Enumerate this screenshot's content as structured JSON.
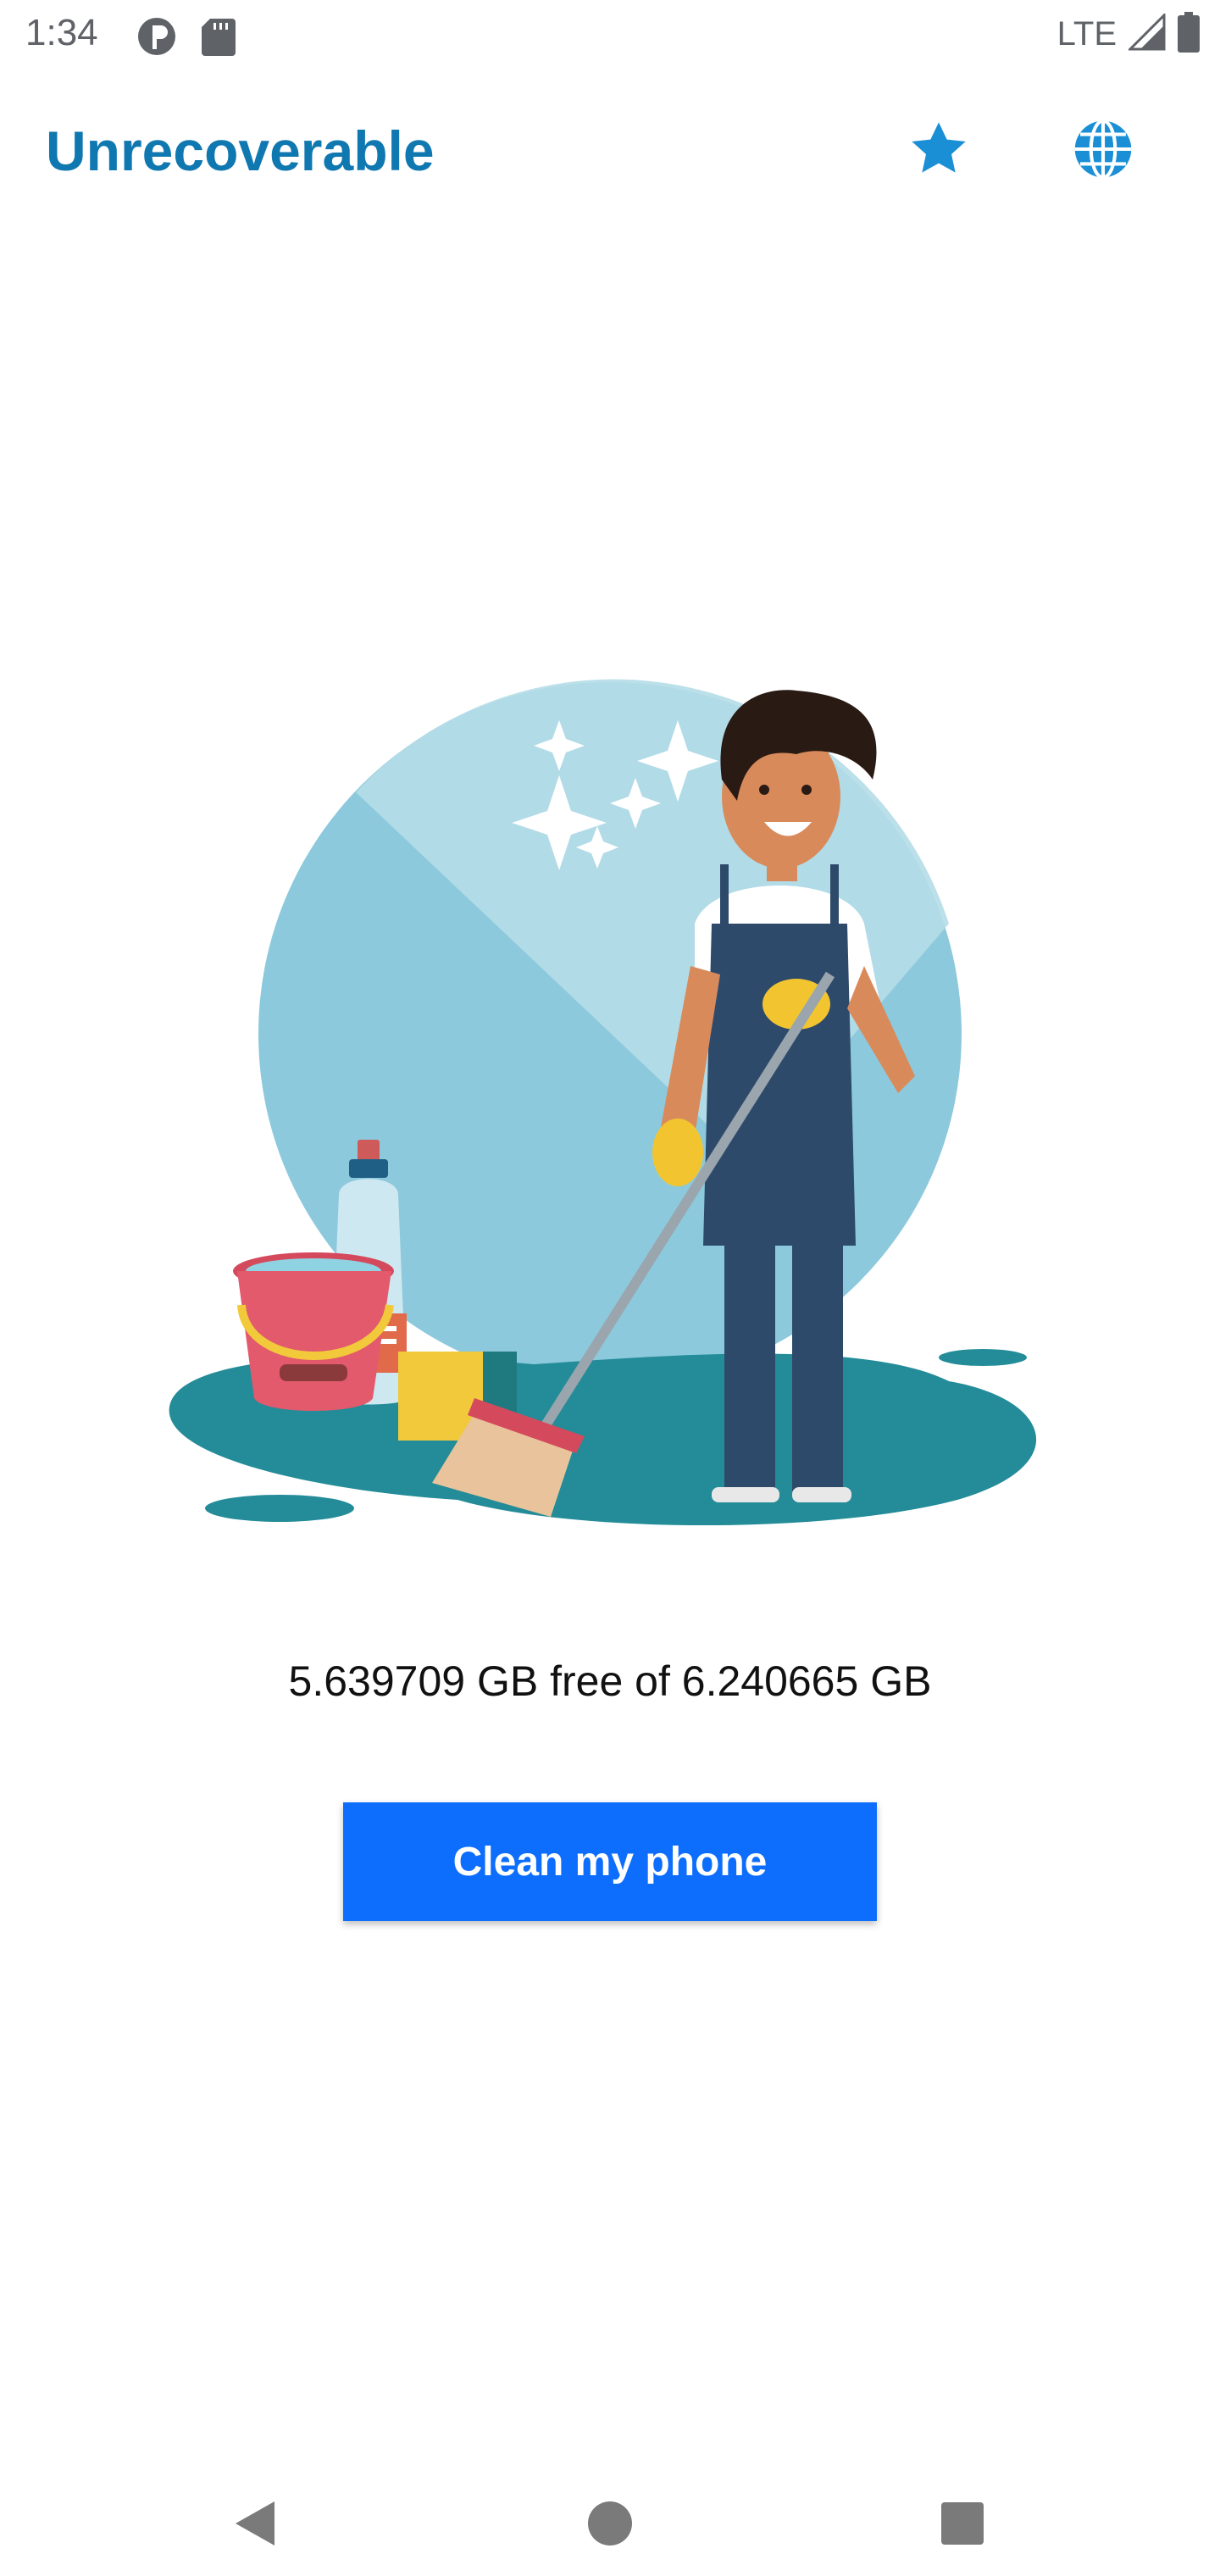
{
  "status_bar": {
    "time": "1:34",
    "network": "LTE",
    "icons": [
      "notification-icon",
      "sd-card-icon",
      "signal-icon",
      "battery-icon"
    ]
  },
  "app_bar": {
    "title": "Unrecoverable",
    "title_color": "#1078b0",
    "actions": [
      "star-icon",
      "globe-icon"
    ]
  },
  "main": {
    "illustration": "cleaning-illustration",
    "storage_text": "5.639709 GB free of 6.240665 GB",
    "clean_button_label": "Clean my phone",
    "button_color": "#0d6efd"
  },
  "nav_bar": {
    "buttons": [
      "back-icon",
      "home-icon",
      "recents-icon"
    ]
  }
}
